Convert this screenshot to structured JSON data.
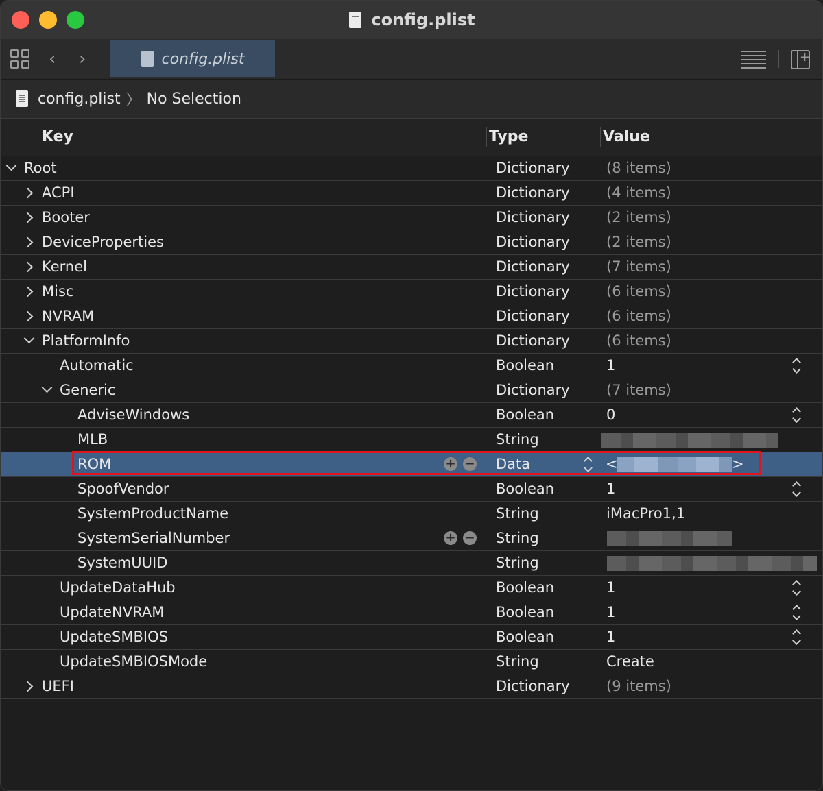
{
  "window": {
    "title": "config.plist"
  },
  "toolbar": {
    "tab_label": "config.plist",
    "back_icon": "chevron-left-icon",
    "forward_icon": "chevron-right-icon"
  },
  "breadcrumb": {
    "file": "config.plist",
    "selection": "No Selection"
  },
  "columns": {
    "key": "Key",
    "type": "Type",
    "value": "Value"
  },
  "rows": [
    {
      "key": "Root",
      "type": "Dictionary",
      "value": "(8 items)"
    },
    {
      "key": "ACPI",
      "type": "Dictionary",
      "value": "(4 items)"
    },
    {
      "key": "Booter",
      "type": "Dictionary",
      "value": "(2 items)"
    },
    {
      "key": "DeviceProperties",
      "type": "Dictionary",
      "value": "(2 items)"
    },
    {
      "key": "Kernel",
      "type": "Dictionary",
      "value": "(7 items)"
    },
    {
      "key": "Misc",
      "type": "Dictionary",
      "value": "(6 items)"
    },
    {
      "key": "NVRAM",
      "type": "Dictionary",
      "value": "(6 items)"
    },
    {
      "key": "PlatformInfo",
      "type": "Dictionary",
      "value": "(6 items)"
    },
    {
      "key": "Automatic",
      "type": "Boolean",
      "value": "1"
    },
    {
      "key": "Generic",
      "type": "Dictionary",
      "value": "(7 items)"
    },
    {
      "key": "AdviseWindows",
      "type": "Boolean",
      "value": "0"
    },
    {
      "key": "MLB",
      "type": "String",
      "value": ""
    },
    {
      "key": "ROM",
      "type": "Data",
      "value": "",
      "open": "<",
      "close": ">"
    },
    {
      "key": "SpoofVendor",
      "type": "Boolean",
      "value": "1"
    },
    {
      "key": "SystemProductName",
      "type": "String",
      "value": "iMacPro1,1"
    },
    {
      "key": "SystemSerialNumber",
      "type": "String",
      "value": ""
    },
    {
      "key": "SystemUUID",
      "type": "String",
      "value": ""
    },
    {
      "key": "UpdateDataHub",
      "type": "Boolean",
      "value": "1"
    },
    {
      "key": "UpdateNVRAM",
      "type": "Boolean",
      "value": "1"
    },
    {
      "key": "UpdateSMBIOS",
      "type": "Boolean",
      "value": "1"
    },
    {
      "key": "UpdateSMBIOSMode",
      "type": "String",
      "value": "Create"
    },
    {
      "key": "UEFI",
      "type": "Dictionary",
      "value": "(9 items)"
    }
  ],
  "row_actions": {
    "add": "+",
    "remove": "−"
  },
  "colors": {
    "selection": "#3e5f86",
    "highlight_box": "#e0141e",
    "tab": "#3a4c62"
  }
}
